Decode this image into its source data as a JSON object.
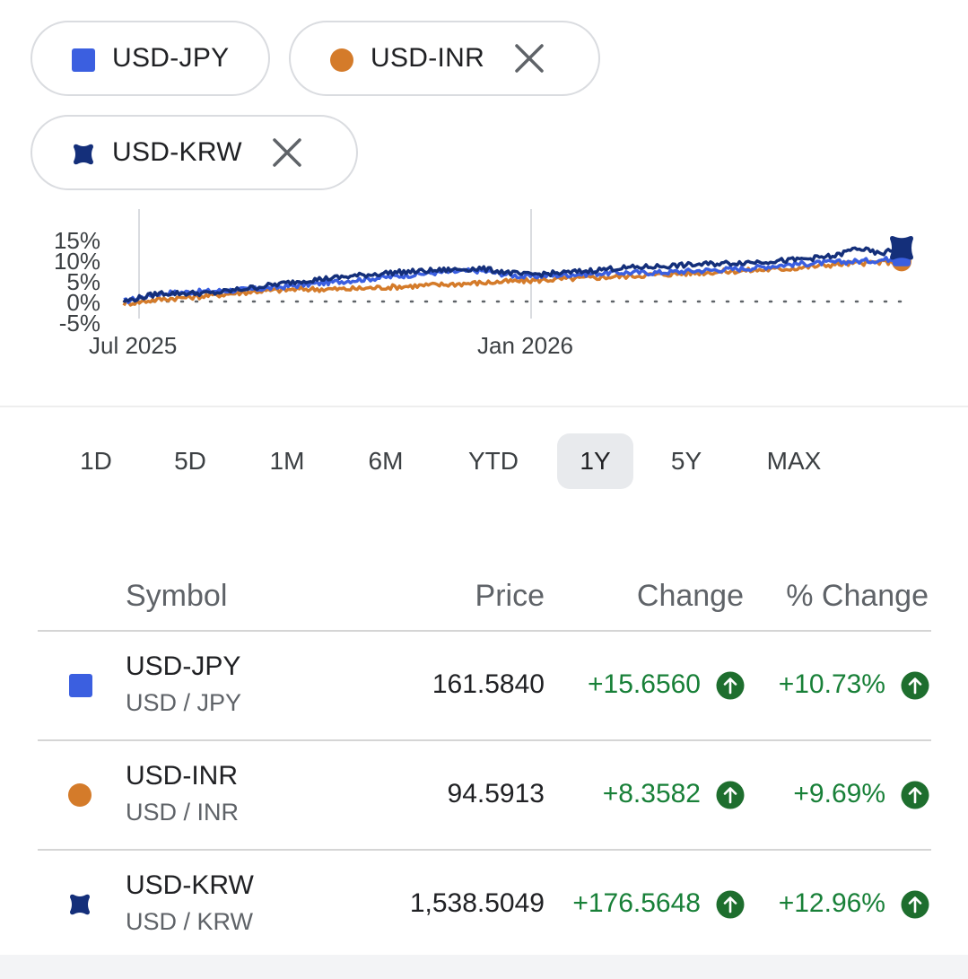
{
  "chips": [
    {
      "label": "USD-JPY",
      "color": "#3b5fe0",
      "marker": "square",
      "removable": false
    },
    {
      "label": "USD-INR",
      "color": "#d47b2a",
      "marker": "circle",
      "removable": true
    },
    {
      "label": "USD-KRW",
      "color": "#142f7a",
      "marker": "blob",
      "removable": true
    }
  ],
  "chart_data": {
    "type": "line",
    "y_ticks": [
      "15%",
      "10%",
      "5%",
      "0%",
      "-5%"
    ],
    "x_ticks": [
      "Jul 2025",
      "Jan 2026"
    ],
    "ylim": [
      -5,
      15
    ],
    "grid": "vertical lines at x ticks; dotted baseline at 0%",
    "legend": "chips at top",
    "series": [
      {
        "name": "USD-JPY",
        "color": "#3b5fe0",
        "points": [
          [
            0,
            0
          ],
          [
            8,
            2
          ],
          [
            20,
            2.5
          ],
          [
            30,
            3
          ],
          [
            40,
            4
          ],
          [
            50,
            5
          ],
          [
            60,
            6
          ],
          [
            70,
            7
          ],
          [
            80,
            7.5
          ],
          [
            90,
            6
          ],
          [
            100,
            6.5
          ],
          [
            110,
            7
          ],
          [
            120,
            7
          ],
          [
            130,
            7.5
          ],
          [
            140,
            8
          ],
          [
            150,
            9
          ],
          [
            160,
            9.5
          ],
          [
            170,
            10
          ],
          [
            175,
            10.7
          ]
        ]
      },
      {
        "name": "USD-INR",
        "color": "#d47b2a",
        "points": [
          [
            0,
            -0.5
          ],
          [
            8,
            0.5
          ],
          [
            20,
            1.5
          ],
          [
            30,
            2.5
          ],
          [
            40,
            3
          ],
          [
            50,
            3
          ],
          [
            60,
            3.5
          ],
          [
            70,
            4
          ],
          [
            80,
            4.5
          ],
          [
            90,
            5
          ],
          [
            100,
            5.5
          ],
          [
            110,
            6
          ],
          [
            120,
            6.5
          ],
          [
            130,
            7
          ],
          [
            140,
            7.5
          ],
          [
            150,
            8
          ],
          [
            160,
            9
          ],
          [
            170,
            9.5
          ],
          [
            175,
            9.7
          ]
        ]
      },
      {
        "name": "USD-KRW",
        "color": "#142f7a",
        "points": [
          [
            0,
            0
          ],
          [
            8,
            2
          ],
          [
            20,
            2
          ],
          [
            30,
            3.5
          ],
          [
            40,
            5
          ],
          [
            50,
            6
          ],
          [
            60,
            7
          ],
          [
            70,
            7.5
          ],
          [
            80,
            8
          ],
          [
            90,
            6.5
          ],
          [
            100,
            7
          ],
          [
            110,
            8
          ],
          [
            120,
            8.5
          ],
          [
            130,
            9
          ],
          [
            140,
            9.5
          ],
          [
            150,
            10
          ],
          [
            160,
            11
          ],
          [
            165,
            13
          ],
          [
            170,
            11.5
          ],
          [
            175,
            13
          ]
        ]
      }
    ]
  },
  "ranges": [
    "1D",
    "5D",
    "1M",
    "6M",
    "YTD",
    "1Y",
    "5Y",
    "MAX"
  ],
  "active_range": "1Y",
  "table": {
    "headers": {
      "symbol": "Symbol",
      "price": "Price",
      "change": "Change",
      "pct": "% Change"
    },
    "rows": [
      {
        "symbol": "USD-JPY",
        "sub": "USD / JPY",
        "price": "161.5840",
        "change": "+15.6560",
        "pct": "+10.73%",
        "color": "#3b5fe0",
        "marker": "square"
      },
      {
        "symbol": "USD-INR",
        "sub": "USD / INR",
        "price": "94.5913",
        "change": "+8.3582",
        "pct": "+9.69%",
        "color": "#d47b2a",
        "marker": "circle"
      },
      {
        "symbol": "USD-KRW",
        "sub": "USD / KRW",
        "price": "1,538.5049",
        "change": "+176.5648",
        "pct": "+12.96%",
        "color": "#142f7a",
        "marker": "blob"
      }
    ]
  },
  "colors": {
    "positive": "#188038",
    "up_badge": "#1e6e2e"
  }
}
